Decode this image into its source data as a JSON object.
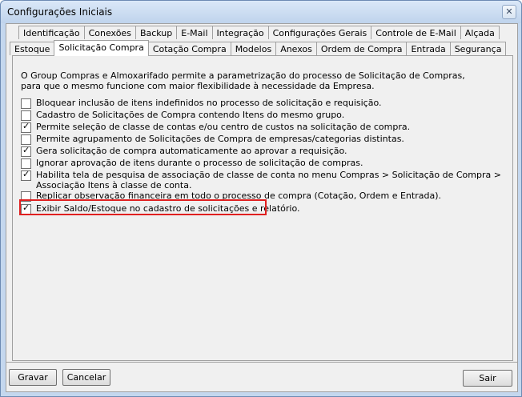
{
  "window": {
    "title": "Configurações Iniciais",
    "close_glyph": "✕"
  },
  "tabs_row1": [
    "Identificação",
    "Conexões",
    "Backup",
    "E-Mail",
    "Integração",
    "Configurações Gerais",
    "Controle de E-Mail",
    "Alçada"
  ],
  "tabs_row2": [
    "Estoque",
    "Solicitação Compra",
    "Cotação Compra",
    "Modelos",
    "Anexos",
    "Ordem de Compra",
    "Entrada",
    "Segurança"
  ],
  "active_tab": "Solicitação Compra",
  "intro": {
    "line1": "O Group Compras e Almoxarifado permite a parametrização do processo de Solicitação de Compras,",
    "line2": "para que o mesmo funcione com maior flexibilidade à necessidade da Empresa."
  },
  "options": [
    {
      "label": "Bloquear inclusão de itens indefinidos no processo de solicitação e requisição.",
      "checked": false
    },
    {
      "label": "Cadastro de Solicitações de Compra contendo Itens do mesmo grupo.",
      "checked": false
    },
    {
      "label": "Permite seleção de classe de contas e/ou centro de custos na solicitação de compra.",
      "checked": true
    },
    {
      "label": "Permite agrupamento de Solicitações de Compra de empresas/categorias distintas.",
      "checked": false
    },
    {
      "label": "Gera solicitação de compra automaticamente ao aprovar a requisição.",
      "checked": true
    },
    {
      "label": "Ignorar aprovação de itens durante o processo de solicitação de compras.",
      "checked": false
    },
    {
      "label": "Habilita tela de pesquisa de associação de classe de conta no menu Compras > Solicitação de Compra >",
      "label2": "Associação Itens à classe de conta.",
      "checked": true
    },
    {
      "label": "Replicar observação financeira em todo o processo de compra (Cotação, Ordem e Entrada).",
      "checked": false
    },
    {
      "label": "Exibir Saldo/Estoque no cadastro de solicitações e relatório.",
      "checked": true
    }
  ],
  "buttons": {
    "save": "Gravar",
    "cancel": "Cancelar",
    "exit": "Sair"
  }
}
